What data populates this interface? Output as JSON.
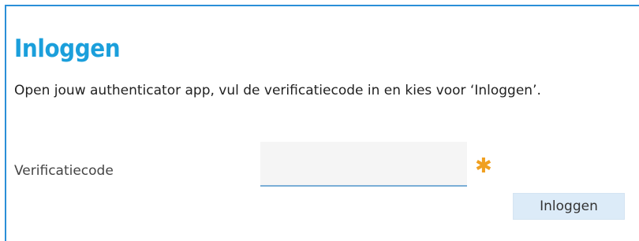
{
  "login": {
    "title": "Inloggen",
    "intro": "Open jouw authenticator app, vul de verificatiecode in en kies voor ‘Inloggen’.",
    "code_label": "Verificatiecode",
    "code_value": "",
    "required_mark": "✱",
    "submit_label": "Inloggen"
  },
  "colors": {
    "accent": "#1b9fdb",
    "border": "#2a8fd8",
    "required": "#f0a020",
    "button_bg": "#dcebf8"
  }
}
